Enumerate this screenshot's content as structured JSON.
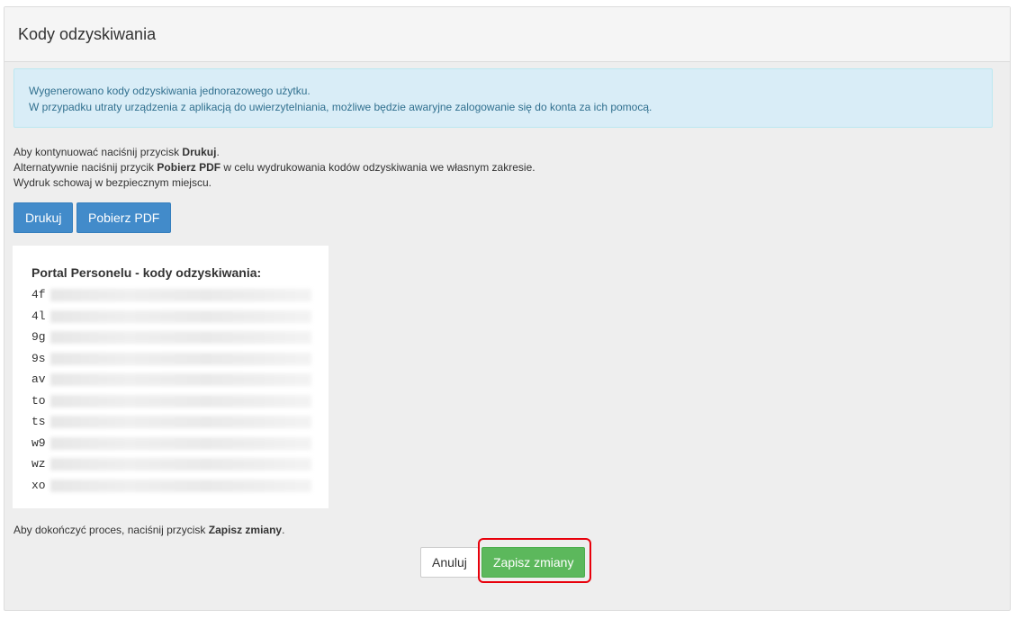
{
  "panel": {
    "title": "Kody odzyskiwania"
  },
  "alert": {
    "line1": "Wygenerowano kody odzyskiwania jednorazowego użytku.",
    "line2": "W przypadku utraty urządzenia z aplikacją do uwierzytelniania, możliwe będzie awaryjne zalogowanie się do konta za ich pomocą."
  },
  "instructions": {
    "line1_prefix": "Aby kontynuować naciśnij przycisk ",
    "line1_bold": "Drukuj",
    "line1_suffix": ".",
    "line2_prefix": "Alternatywnie naciśnij przycik ",
    "line2_bold": "Pobierz PDF",
    "line2_suffix": " w celu wydrukowania kodów odzyskiwania we własnym zakresie.",
    "line3": "Wydruk schowaj w bezpiecznym miejscu."
  },
  "buttons": {
    "print": "Drukuj",
    "pdf": "Pobierz PDF",
    "cancel": "Anuluj",
    "save": "Zapisz zmiany"
  },
  "codes": {
    "title": "Portal Personelu - kody odzyskiwania:",
    "items": [
      "4f",
      "4l",
      "9g",
      "9s",
      "av",
      "to",
      "ts",
      "w9",
      "wz",
      "xo"
    ]
  },
  "finish": {
    "prefix": "Aby dokończyć proces, naciśnij przycisk ",
    "bold": "Zapisz zmiany",
    "suffix": "."
  },
  "colors": {
    "primary": "#428bca",
    "success": "#5cb85c",
    "alert_bg": "#d9edf7",
    "alert_text": "#31708f",
    "highlight": "#e8000b"
  }
}
